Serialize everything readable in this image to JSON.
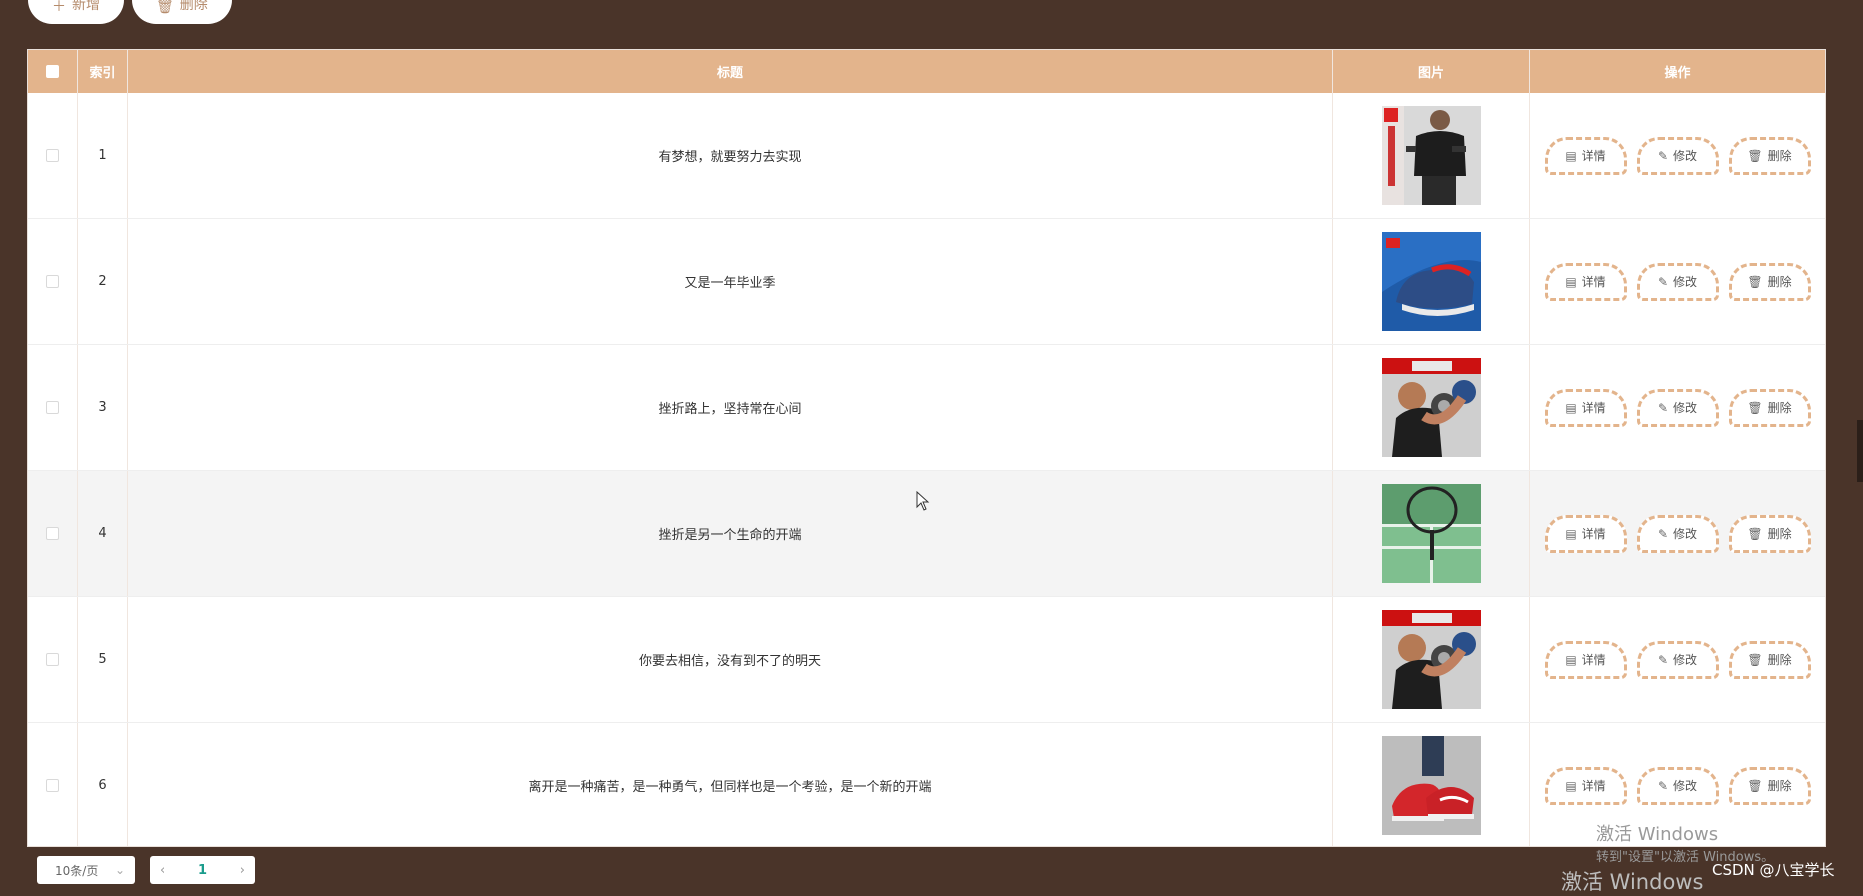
{
  "toolbar": {
    "add_label": "新增",
    "delete_label": "删除"
  },
  "table": {
    "headers": {
      "index": "索引",
      "title": "标题",
      "image": "图片",
      "actions": "操作"
    },
    "rows": [
      {
        "index": "1",
        "title": "有梦想，就要努力去实现"
      },
      {
        "index": "2",
        "title": "又是一年毕业季"
      },
      {
        "index": "3",
        "title": "挫折路上，坚持常在心间"
      },
      {
        "index": "4",
        "title": "挫折是另一个生命的开端"
      },
      {
        "index": "5",
        "title": "你要去相信，没有到不了的明天"
      },
      {
        "index": "6",
        "title": "离开是一种痛苦，是一种勇气，但同样也是一个考验，是一个新的开端"
      }
    ],
    "actions": {
      "detail": "详情",
      "edit": "修改",
      "delete": "删除"
    }
  },
  "pagination": {
    "page_size": "10条/页",
    "current_page": "1"
  },
  "watermark": {
    "line1": "激活 Windows",
    "line2": "转到\"设置\"以激活 Windows。",
    "line3": "激活 Windows"
  },
  "credit": "CSDN @八宝学长",
  "colors": {
    "background": "#4a3429",
    "header": "#e3b48c",
    "accent": "#b58b6b"
  }
}
